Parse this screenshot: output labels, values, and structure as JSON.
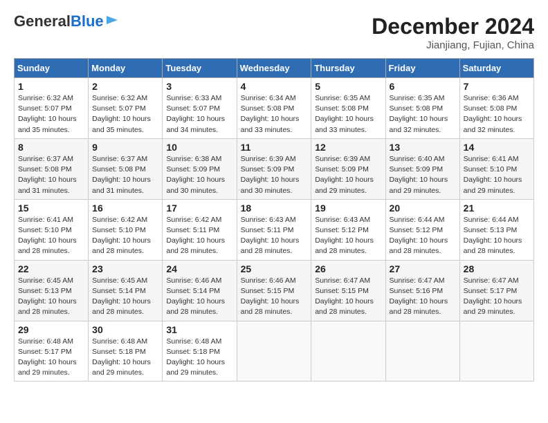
{
  "header": {
    "logo_general": "General",
    "logo_blue": "Blue",
    "month_year": "December 2024",
    "location": "Jianjiang, Fujian, China"
  },
  "calendar": {
    "days_of_week": [
      "Sunday",
      "Monday",
      "Tuesday",
      "Wednesday",
      "Thursday",
      "Friday",
      "Saturday"
    ],
    "weeks": [
      [
        {
          "day": "",
          "info": ""
        },
        {
          "day": "2",
          "info": "Sunrise: 6:32 AM\nSunset: 5:07 PM\nDaylight: 10 hours\nand 35 minutes."
        },
        {
          "day": "3",
          "info": "Sunrise: 6:33 AM\nSunset: 5:07 PM\nDaylight: 10 hours\nand 34 minutes."
        },
        {
          "day": "4",
          "info": "Sunrise: 6:34 AM\nSunset: 5:08 PM\nDaylight: 10 hours\nand 33 minutes."
        },
        {
          "day": "5",
          "info": "Sunrise: 6:35 AM\nSunset: 5:08 PM\nDaylight: 10 hours\nand 33 minutes."
        },
        {
          "day": "6",
          "info": "Sunrise: 6:35 AM\nSunset: 5:08 PM\nDaylight: 10 hours\nand 32 minutes."
        },
        {
          "day": "7",
          "info": "Sunrise: 6:36 AM\nSunset: 5:08 PM\nDaylight: 10 hours\nand 32 minutes."
        }
      ],
      [
        {
          "day": "8",
          "info": "Sunrise: 6:37 AM\nSunset: 5:08 PM\nDaylight: 10 hours\nand 31 minutes."
        },
        {
          "day": "9",
          "info": "Sunrise: 6:37 AM\nSunset: 5:08 PM\nDaylight: 10 hours\nand 31 minutes."
        },
        {
          "day": "10",
          "info": "Sunrise: 6:38 AM\nSunset: 5:09 PM\nDaylight: 10 hours\nand 30 minutes."
        },
        {
          "day": "11",
          "info": "Sunrise: 6:39 AM\nSunset: 5:09 PM\nDaylight: 10 hours\nand 30 minutes."
        },
        {
          "day": "12",
          "info": "Sunrise: 6:39 AM\nSunset: 5:09 PM\nDaylight: 10 hours\nand 29 minutes."
        },
        {
          "day": "13",
          "info": "Sunrise: 6:40 AM\nSunset: 5:09 PM\nDaylight: 10 hours\nand 29 minutes."
        },
        {
          "day": "14",
          "info": "Sunrise: 6:41 AM\nSunset: 5:10 PM\nDaylight: 10 hours\nand 29 minutes."
        }
      ],
      [
        {
          "day": "15",
          "info": "Sunrise: 6:41 AM\nSunset: 5:10 PM\nDaylight: 10 hours\nand 28 minutes."
        },
        {
          "day": "16",
          "info": "Sunrise: 6:42 AM\nSunset: 5:10 PM\nDaylight: 10 hours\nand 28 minutes."
        },
        {
          "day": "17",
          "info": "Sunrise: 6:42 AM\nSunset: 5:11 PM\nDaylight: 10 hours\nand 28 minutes."
        },
        {
          "day": "18",
          "info": "Sunrise: 6:43 AM\nSunset: 5:11 PM\nDaylight: 10 hours\nand 28 minutes."
        },
        {
          "day": "19",
          "info": "Sunrise: 6:43 AM\nSunset: 5:12 PM\nDaylight: 10 hours\nand 28 minutes."
        },
        {
          "day": "20",
          "info": "Sunrise: 6:44 AM\nSunset: 5:12 PM\nDaylight: 10 hours\nand 28 minutes."
        },
        {
          "day": "21",
          "info": "Sunrise: 6:44 AM\nSunset: 5:13 PM\nDaylight: 10 hours\nand 28 minutes."
        }
      ],
      [
        {
          "day": "22",
          "info": "Sunrise: 6:45 AM\nSunset: 5:13 PM\nDaylight: 10 hours\nand 28 minutes."
        },
        {
          "day": "23",
          "info": "Sunrise: 6:45 AM\nSunset: 5:14 PM\nDaylight: 10 hours\nand 28 minutes."
        },
        {
          "day": "24",
          "info": "Sunrise: 6:46 AM\nSunset: 5:14 PM\nDaylight: 10 hours\nand 28 minutes."
        },
        {
          "day": "25",
          "info": "Sunrise: 6:46 AM\nSunset: 5:15 PM\nDaylight: 10 hours\nand 28 minutes."
        },
        {
          "day": "26",
          "info": "Sunrise: 6:47 AM\nSunset: 5:15 PM\nDaylight: 10 hours\nand 28 minutes."
        },
        {
          "day": "27",
          "info": "Sunrise: 6:47 AM\nSunset: 5:16 PM\nDaylight: 10 hours\nand 28 minutes."
        },
        {
          "day": "28",
          "info": "Sunrise: 6:47 AM\nSunset: 5:17 PM\nDaylight: 10 hours\nand 29 minutes."
        }
      ],
      [
        {
          "day": "29",
          "info": "Sunrise: 6:48 AM\nSunset: 5:17 PM\nDaylight: 10 hours\nand 29 minutes."
        },
        {
          "day": "30",
          "info": "Sunrise: 6:48 AM\nSunset: 5:18 PM\nDaylight: 10 hours\nand 29 minutes."
        },
        {
          "day": "31",
          "info": "Sunrise: 6:48 AM\nSunset: 5:18 PM\nDaylight: 10 hours\nand 29 minutes."
        },
        {
          "day": "",
          "info": ""
        },
        {
          "day": "",
          "info": ""
        },
        {
          "day": "",
          "info": ""
        },
        {
          "day": "",
          "info": ""
        }
      ]
    ],
    "week1_sun": {
      "day": "1",
      "info": "Sunrise: 6:32 AM\nSunset: 5:07 PM\nDaylight: 10 hours\nand 35 minutes."
    }
  }
}
